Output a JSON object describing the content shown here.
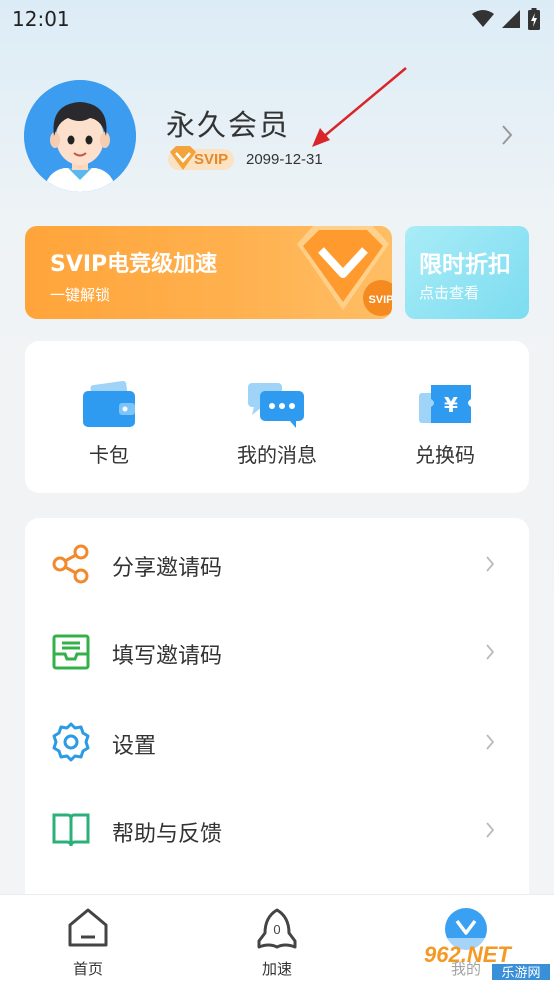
{
  "status_bar": {
    "time": "12:01",
    "icons": [
      "wifi-icon",
      "signal-icon",
      "battery-charging-icon"
    ]
  },
  "profile": {
    "title": "永久会员",
    "badge": "SVIP",
    "expiry": "2099-12-31"
  },
  "banners": {
    "svip": {
      "title": "SVIP电竞级加速",
      "subtitle": "一键解锁",
      "emblem_label": "SVIP"
    },
    "discount": {
      "title": "限时折扣",
      "subtitle": "点击查看"
    }
  },
  "quick_actions": [
    {
      "label": "卡包",
      "icon": "wallet-icon"
    },
    {
      "label": "我的消息",
      "icon": "message-icon"
    },
    {
      "label": "兑换码",
      "icon": "coupon-icon"
    }
  ],
  "menu": [
    {
      "label": "分享邀请码",
      "icon": "share-icon",
      "color": "#f08a2c"
    },
    {
      "label": "填写邀请码",
      "icon": "mail-icon",
      "color": "#34b04a"
    },
    {
      "label": "设置",
      "icon": "gear-icon",
      "color": "#2b9be6"
    },
    {
      "label": "帮助与反馈",
      "icon": "book-icon",
      "color": "#2bb07a"
    }
  ],
  "bottom_nav": [
    {
      "label": "首页",
      "icon": "home-icon"
    },
    {
      "label": "加速",
      "icon": "boost-icon",
      "badge": "0"
    },
    {
      "label": "我的",
      "icon": "profile-icon"
    }
  ],
  "watermark": {
    "brand": "962.NET",
    "text": "乐游网"
  },
  "colors": {
    "accent_orange": "#ffa43a",
    "accent_cyan": "#7cdcf0",
    "annotation_red": "#d9252a"
  }
}
